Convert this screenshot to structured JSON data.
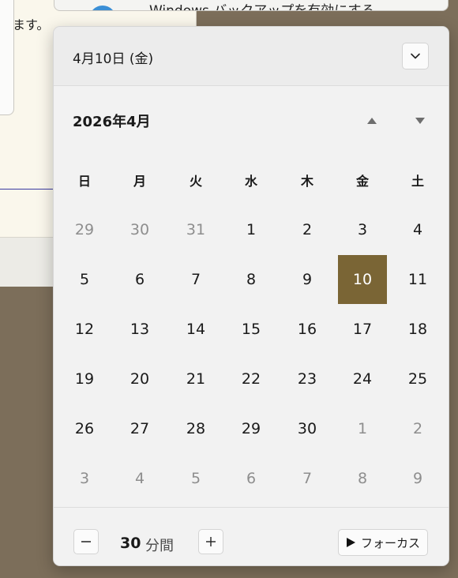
{
  "background": {
    "window_text": "ます。",
    "notification_text": "Windows バックアップを有効にする"
  },
  "flyout": {
    "header": {
      "date": "4月10日 (金)",
      "collapse_icon": "chevron-down-icon"
    },
    "calendar": {
      "month_title": "2026年4月",
      "prev_icon": "triangle-up-icon",
      "next_icon": "triangle-down-icon",
      "weekdays": [
        "日",
        "月",
        "火",
        "水",
        "木",
        "金",
        "土"
      ],
      "weeks": [
        [
          "29",
          "30",
          "31",
          "1",
          "2",
          "3",
          "4"
        ],
        [
          "5",
          "6",
          "7",
          "8",
          "9",
          "10",
          "11"
        ],
        [
          "12",
          "13",
          "14",
          "15",
          "16",
          "17",
          "18"
        ],
        [
          "19",
          "20",
          "21",
          "22",
          "23",
          "24",
          "25"
        ],
        [
          "26",
          "27",
          "28",
          "29",
          "30",
          "1",
          "2"
        ],
        [
          "3",
          "4",
          "5",
          "6",
          "7",
          "8",
          "9"
        ]
      ],
      "selected_day": "10",
      "selected_color": "#7a6535"
    },
    "footer": {
      "minus_icon": "minus-icon",
      "plus_icon": "plus-icon",
      "duration_value": "30",
      "duration_unit": "分間",
      "focus_label": "フォーカス",
      "focus_icon": "play-icon"
    }
  }
}
